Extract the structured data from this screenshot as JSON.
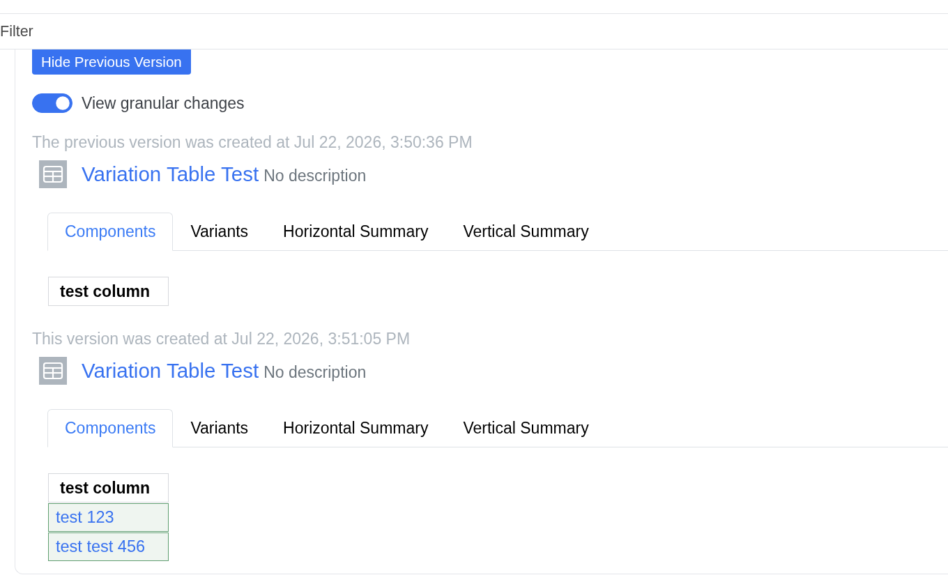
{
  "filter_bar": {
    "label": "Filter"
  },
  "hide_previous_button": {
    "label": "Hide Previous Version"
  },
  "granular_toggle": {
    "label": "View granular changes",
    "on": true
  },
  "versions": [
    {
      "created_note": "The previous version was created at Jul 22, 2026, 3:50:36 PM",
      "title": "Variation Table Test",
      "description": "No description",
      "tabs": [
        {
          "label": "Components",
          "selected": true
        },
        {
          "label": "Variants",
          "selected": false
        },
        {
          "label": "Horizontal Summary",
          "selected": false
        },
        {
          "label": "Vertical Summary",
          "selected": false
        }
      ],
      "table": {
        "columns": [
          "test column"
        ]
      }
    },
    {
      "created_note": "This version was created at Jul 22, 2026, 3:51:05 PM",
      "title": "Variation Table Test",
      "description": "No description",
      "tabs": [
        {
          "label": "Components",
          "selected": true
        },
        {
          "label": "Variants",
          "selected": false
        },
        {
          "label": "Horizontal Summary",
          "selected": false
        },
        {
          "label": "Vertical Summary",
          "selected": false
        }
      ],
      "table": {
        "columns": [
          "test column"
        ],
        "rows": [
          {
            "cells": [
              "test 123"
            ],
            "added": true
          },
          {
            "cells": [
              "test test 456"
            ],
            "added": true
          }
        ]
      }
    }
  ]
}
